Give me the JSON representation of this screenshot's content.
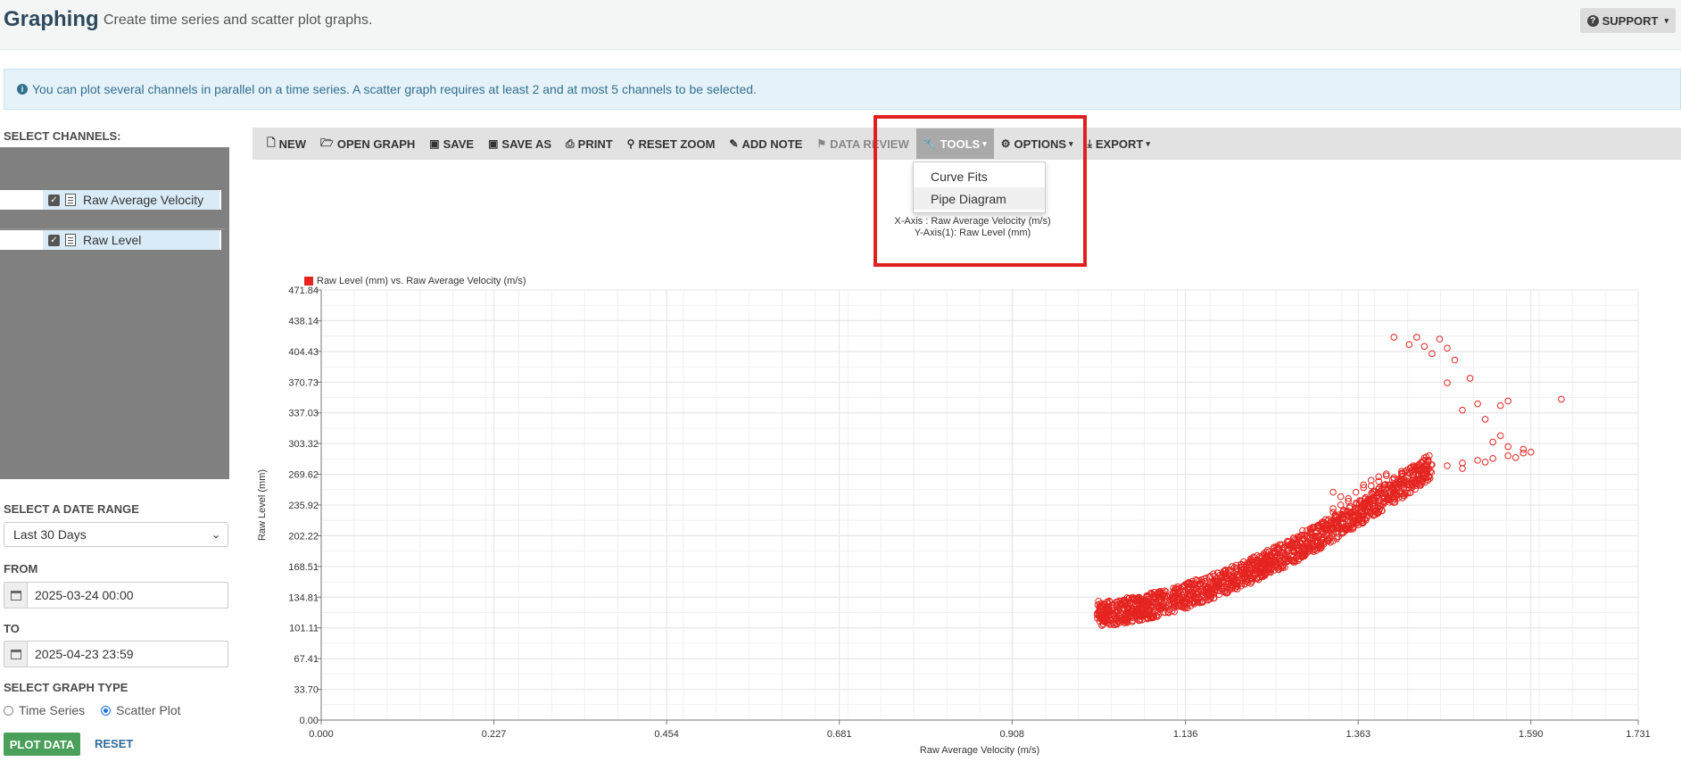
{
  "header": {
    "title": "Graphing",
    "subtitle": "Create time series and scatter plot graphs.",
    "support_label": "SUPPORT"
  },
  "info_banner": "You can plot several channels in parallel on a time series. A scatter graph requires at least 2 and at most 5 channels to be selected.",
  "left_panel": {
    "select_channels_label": "SELECT CHANNELS:",
    "channels": [
      {
        "label": "Raw Average Velocity",
        "checked": true
      },
      {
        "label": "Raw Level",
        "checked": true
      }
    ],
    "date_range_label": "SELECT A DATE RANGE",
    "date_range_value": "Last 30 Days",
    "from_label": "FROM",
    "from_value": "2025-03-24 00:00",
    "to_label": "TO",
    "to_value": "2025-04-23 23:59",
    "graph_type_label": "SELECT GRAPH TYPE",
    "graph_types": [
      {
        "label": "Time Series",
        "selected": false
      },
      {
        "label": "Scatter Plot",
        "selected": true
      }
    ],
    "plot_button": "PLOT DATA",
    "reset_button": "RESET"
  },
  "toolbar": {
    "new": "NEW",
    "open_graph": "OPEN GRAPH",
    "save": "SAVE",
    "save_as": "SAVE AS",
    "print": "PRINT",
    "reset_zoom": "RESET ZOOM",
    "add_note": "ADD NOTE",
    "data_review": "DATA REVIEW",
    "tools": "TOOLS",
    "options": "OPTIONS",
    "export": "EXPORT"
  },
  "tools_menu": {
    "items": [
      "Curve Fits",
      "Pipe Diagram"
    ]
  },
  "colors": {
    "accent_red": "#e52420",
    "highlight_box": "#e02020",
    "plot_button": "#4aa05a",
    "info_bg": "#e6f2f9"
  },
  "chart_data": {
    "type": "scatter",
    "title_lines": [
      "X-Axis : Raw Average Velocity (m/s)",
      "Y-Axis(1): Raw Level (mm)"
    ],
    "legend": "Raw Level (mm) vs. Raw Average Velocity (m/s)",
    "xlabel": "Raw Average Velocity (m/s)",
    "ylabel": "Raw Level (mm)",
    "xlim": [
      0,
      1.731
    ],
    "ylim": [
      0,
      471.84
    ],
    "x_ticks": [
      "0.000",
      "0.227",
      "0.454",
      "0.681",
      "0.908",
      "1.136",
      "1.363",
      "1.590",
      "1.731"
    ],
    "y_ticks": [
      "0.00",
      "33.70",
      "67.41",
      "101.11",
      "134.81",
      "168.51",
      "202.22",
      "235.92",
      "269.62",
      "303.32",
      "337.03",
      "370.73",
      "404.43",
      "438.14",
      "471.84"
    ],
    "grid": true,
    "series": [
      {
        "name": "Raw Level (mm) vs. Raw Average Velocity (m/s)",
        "color": "#e52420",
        "points": [
          [
            1.02,
            117
          ],
          [
            1.03,
            120
          ],
          [
            1.04,
            115
          ],
          [
            1.05,
            118
          ],
          [
            1.06,
            122
          ],
          [
            1.07,
            119
          ],
          [
            1.08,
            124
          ],
          [
            1.09,
            126
          ],
          [
            1.1,
            125
          ],
          [
            1.11,
            129
          ],
          [
            1.12,
            131
          ],
          [
            1.13,
            133
          ],
          [
            1.14,
            136
          ],
          [
            1.15,
            138
          ],
          [
            1.16,
            141
          ],
          [
            1.17,
            143
          ],
          [
            1.18,
            146
          ],
          [
            1.19,
            149
          ],
          [
            1.2,
            152
          ],
          [
            1.21,
            156
          ],
          [
            1.22,
            160
          ],
          [
            1.23,
            165
          ],
          [
            1.24,
            170
          ],
          [
            1.25,
            175
          ],
          [
            1.26,
            181
          ],
          [
            1.27,
            187
          ],
          [
            1.28,
            193
          ],
          [
            1.29,
            199
          ],
          [
            1.3,
            206
          ],
          [
            1.31,
            213
          ],
          [
            1.32,
            220
          ],
          [
            1.33,
            228
          ],
          [
            1.34,
            236
          ],
          [
            1.35,
            243
          ],
          [
            1.36,
            250
          ],
          [
            1.37,
            258
          ],
          [
            1.38,
            263
          ],
          [
            1.39,
            267
          ],
          [
            1.4,
            270
          ],
          [
            1.42,
            273
          ],
          [
            1.45,
            276
          ],
          [
            1.48,
            279
          ],
          [
            1.5,
            282
          ],
          [
            1.52,
            285
          ],
          [
            1.54,
            287
          ],
          [
            1.56,
            290
          ],
          [
            1.58,
            293
          ],
          [
            1.59,
            294
          ],
          [
            1.54,
            305
          ],
          [
            1.55,
            312
          ],
          [
            1.56,
            300
          ],
          [
            1.53,
            330
          ],
          [
            1.55,
            345
          ],
          [
            1.56,
            350
          ],
          [
            1.5,
            340
          ],
          [
            1.52,
            347
          ],
          [
            1.48,
            370
          ],
          [
            1.51,
            375
          ],
          [
            1.44,
            420
          ],
          [
            1.45,
            410
          ],
          [
            1.46,
            402
          ],
          [
            1.47,
            418
          ],
          [
            1.48,
            408
          ],
          [
            1.49,
            395
          ],
          [
            1.41,
            420
          ],
          [
            1.43,
            412
          ],
          [
            1.63,
            352
          ],
          [
            1.15,
            145
          ],
          [
            1.2,
            158
          ],
          [
            1.25,
            178
          ],
          [
            1.3,
            210
          ],
          [
            1.35,
            240
          ],
          [
            1.08,
            130
          ],
          [
            1.12,
            140
          ],
          [
            1.18,
            150
          ],
          [
            1.22,
            170
          ],
          [
            1.28,
            198
          ],
          [
            1.33,
            232
          ],
          [
            1.37,
            255
          ],
          [
            1.4,
            268
          ],
          [
            1.11,
            124
          ],
          [
            1.16,
            136
          ],
          [
            1.21,
            150
          ],
          [
            1.26,
            171
          ],
          [
            1.31,
            202
          ],
          [
            1.36,
            238
          ],
          [
            1.39,
            262
          ],
          [
            1.43,
            272
          ],
          [
            1.06,
            127
          ],
          [
            1.14,
            142
          ],
          [
            1.19,
            156
          ],
          [
            1.24,
            180
          ],
          [
            1.29,
            208
          ],
          [
            1.34,
            245
          ],
          [
            1.38,
            257
          ],
          [
            1.33,
            250
          ],
          [
            1.46,
            280
          ],
          [
            1.5,
            276
          ],
          [
            1.57,
            288
          ],
          [
            1.58,
            297
          ],
          [
            1.53,
            283
          ],
          [
            1.44,
            274
          ],
          [
            1.41,
            266
          ],
          [
            1.42,
            270
          ]
        ]
      }
    ]
  }
}
